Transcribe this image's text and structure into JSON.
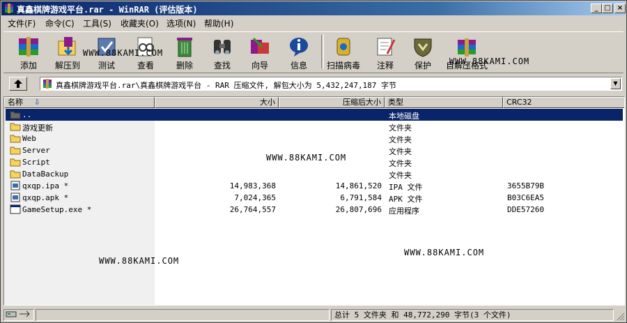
{
  "window": {
    "title": "真鑫棋牌游戏平台.rar - WinRAR (评估版本)"
  },
  "menu": [
    "文件(F)",
    "命令(C)",
    "工具(S)",
    "收藏夹(O)",
    "选项(N)",
    "帮助(H)"
  ],
  "toolbar": [
    {
      "label": "添加",
      "icon": "add-archive-icon"
    },
    {
      "label": "解压到",
      "icon": "extract-to-icon"
    },
    {
      "label": "测试",
      "icon": "test-icon"
    },
    {
      "label": "查看",
      "icon": "view-icon"
    },
    {
      "label": "删除",
      "icon": "delete-icon"
    },
    {
      "label": "查找",
      "icon": "find-icon"
    },
    {
      "label": "向导",
      "icon": "wizard-icon"
    },
    {
      "label": "信息",
      "icon": "info-icon"
    },
    {
      "label": "扫描病毒",
      "icon": "virus-scan-icon"
    },
    {
      "label": "注释",
      "icon": "comment-icon"
    },
    {
      "label": "保护",
      "icon": "protect-icon"
    },
    {
      "label": "自解压格式",
      "icon": "sfx-icon"
    }
  ],
  "address": {
    "path": "真鑫棋牌游戏平台.rar\\真鑫棋牌游戏平台 - RAR 压缩文件, 解包大小为 5,432,247,187 字节"
  },
  "columns": {
    "name": "名称",
    "size": "大小",
    "packed": "压缩后大小",
    "type": "类型",
    "crc": "CRC32"
  },
  "files": [
    {
      "name": "..",
      "size": "",
      "packed": "",
      "type": "本地磁盘",
      "crc": "",
      "kind": "parent",
      "selected": true
    },
    {
      "name": "游戏更新",
      "size": "",
      "packed": "",
      "type": "文件夹",
      "crc": "",
      "kind": "folder"
    },
    {
      "name": "Web",
      "size": "",
      "packed": "",
      "type": "文件夹",
      "crc": "",
      "kind": "folder"
    },
    {
      "name": "Server",
      "size": "",
      "packed": "",
      "type": "文件夹",
      "crc": "",
      "kind": "folder"
    },
    {
      "name": "Script",
      "size": "",
      "packed": "",
      "type": "文件夹",
      "crc": "",
      "kind": "folder"
    },
    {
      "name": "DataBackup",
      "size": "",
      "packed": "",
      "type": "文件夹",
      "crc": "",
      "kind": "folder"
    },
    {
      "name": "qxqp.ipa *",
      "size": "14,983,368",
      "packed": "14,861,520",
      "type": "IPA 文件",
      "crc": "3655B79B",
      "kind": "file"
    },
    {
      "name": "qxqp.apk *",
      "size": "7,024,365",
      "packed": "6,791,584",
      "type": "APK 文件",
      "crc": "B03C6EA5",
      "kind": "file"
    },
    {
      "name": "GameSetup.exe *",
      "size": "26,764,557",
      "packed": "26,807,696",
      "type": "应用程序",
      "crc": "DDE57260",
      "kind": "exe"
    }
  ],
  "watermark": "WWW.88KAMI.COM",
  "status": {
    "summary": "总计 5 文件夹 和 48,772,290 字节(3 个文件)"
  },
  "colors": {
    "titlebar": "#0a246a",
    "selection": "#0a246a",
    "folder": "#f4d35e"
  }
}
